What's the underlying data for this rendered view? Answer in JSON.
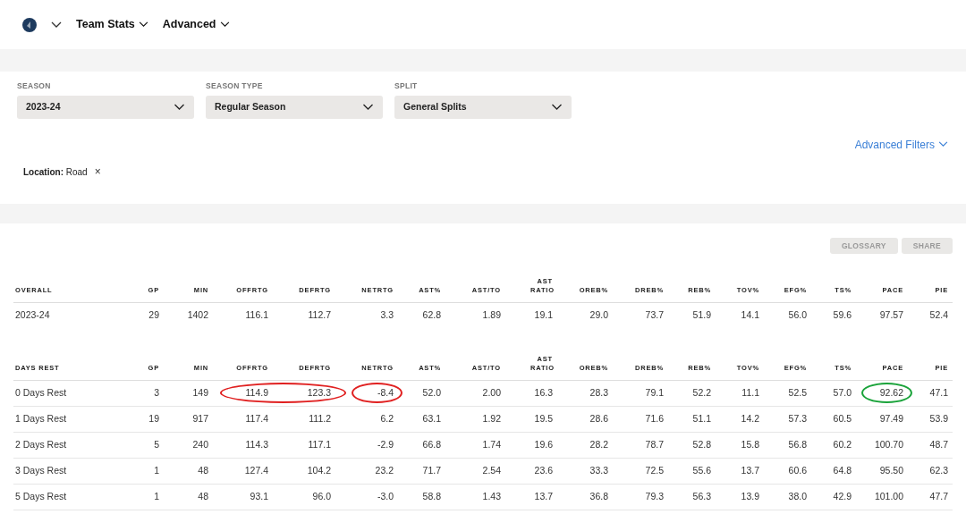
{
  "nav": {
    "items": [
      {
        "label": "Team Stats"
      },
      {
        "label": "Advanced"
      }
    ]
  },
  "filters": [
    {
      "label": "SEASON",
      "value": "2023-24"
    },
    {
      "label": "SEASON TYPE",
      "value": "Regular Season"
    },
    {
      "label": "SPLIT",
      "value": "General Splits"
    }
  ],
  "advanced_filters": {
    "label": "Advanced Filters"
  },
  "active_filter": {
    "name": "Location:",
    "value": "Road",
    "remove": "×"
  },
  "actions": [
    "GLOSSARY",
    "SHARE"
  ],
  "overall": {
    "columns": [
      "OVERALL",
      "GP",
      "MIN",
      "OFFRTG",
      "DEFRTG",
      "NETRTG",
      "AST%",
      "AST/TO",
      "AST RATIO",
      "OREB%",
      "DREB%",
      "REB%",
      "TOV%",
      "EFG%",
      "TS%",
      "PACE",
      "PIE"
    ],
    "rows": [
      [
        "2023-24",
        "29",
        "1402",
        "116.1",
        "112.7",
        "3.3",
        "62.8",
        "1.89",
        "19.1",
        "29.0",
        "73.7",
        "51.9",
        "14.1",
        "56.0",
        "59.6",
        "97.57",
        "52.4"
      ]
    ]
  },
  "days_rest": {
    "columns": [
      "DAYS REST",
      "GP",
      "MIN",
      "OFFRTG",
      "DEFRTG",
      "NETRTG",
      "AST%",
      "AST/TO",
      "AST RATIO",
      "OREB%",
      "DREB%",
      "REB%",
      "TOV%",
      "EFG%",
      "TS%",
      "PACE",
      "PIE"
    ],
    "rows": [
      [
        "0 Days Rest",
        "3",
        "149",
        {
          "text": "114.9",
          "color": "#e02020",
          "joins_next": true
        },
        {
          "text": "123.3",
          "color": "#e02020",
          "joins_next": false
        },
        {
          "text": "-8.4",
          "color": "#e02020",
          "joins_next": false
        },
        "52.0",
        "2.00",
        "16.3",
        "28.3",
        "79.1",
        "52.2",
        "11.1",
        "52.5",
        "57.0",
        {
          "text": "92.62",
          "color": "#1aa33a",
          "joins_next": false
        },
        "47.1"
      ],
      [
        "1 Days Rest",
        "19",
        "917",
        "117.4",
        "111.2",
        "6.2",
        "63.1",
        "1.92",
        "19.5",
        "28.6",
        "71.6",
        "51.1",
        "14.2",
        "57.3",
        "60.5",
        "97.49",
        "53.9"
      ],
      [
        "2 Days Rest",
        "5",
        "240",
        "114.3",
        "117.1",
        "-2.9",
        "66.8",
        "1.74",
        "19.6",
        "28.2",
        "78.7",
        "52.8",
        "15.8",
        "56.8",
        "60.2",
        "100.70",
        "48.7"
      ],
      [
        "3 Days Rest",
        "1",
        "48",
        "127.4",
        "104.2",
        "23.2",
        "71.7",
        "2.54",
        "23.6",
        "33.3",
        "72.5",
        "55.6",
        "13.7",
        "60.6",
        "64.8",
        "95.50",
        "62.3"
      ],
      [
        "5 Days Rest",
        "1",
        "48",
        "93.1",
        "96.0",
        "-3.0",
        "58.8",
        "1.43",
        "13.7",
        "36.8",
        "79.3",
        "56.3",
        "13.9",
        "38.0",
        "42.9",
        "101.00",
        "47.7"
      ]
    ]
  }
}
